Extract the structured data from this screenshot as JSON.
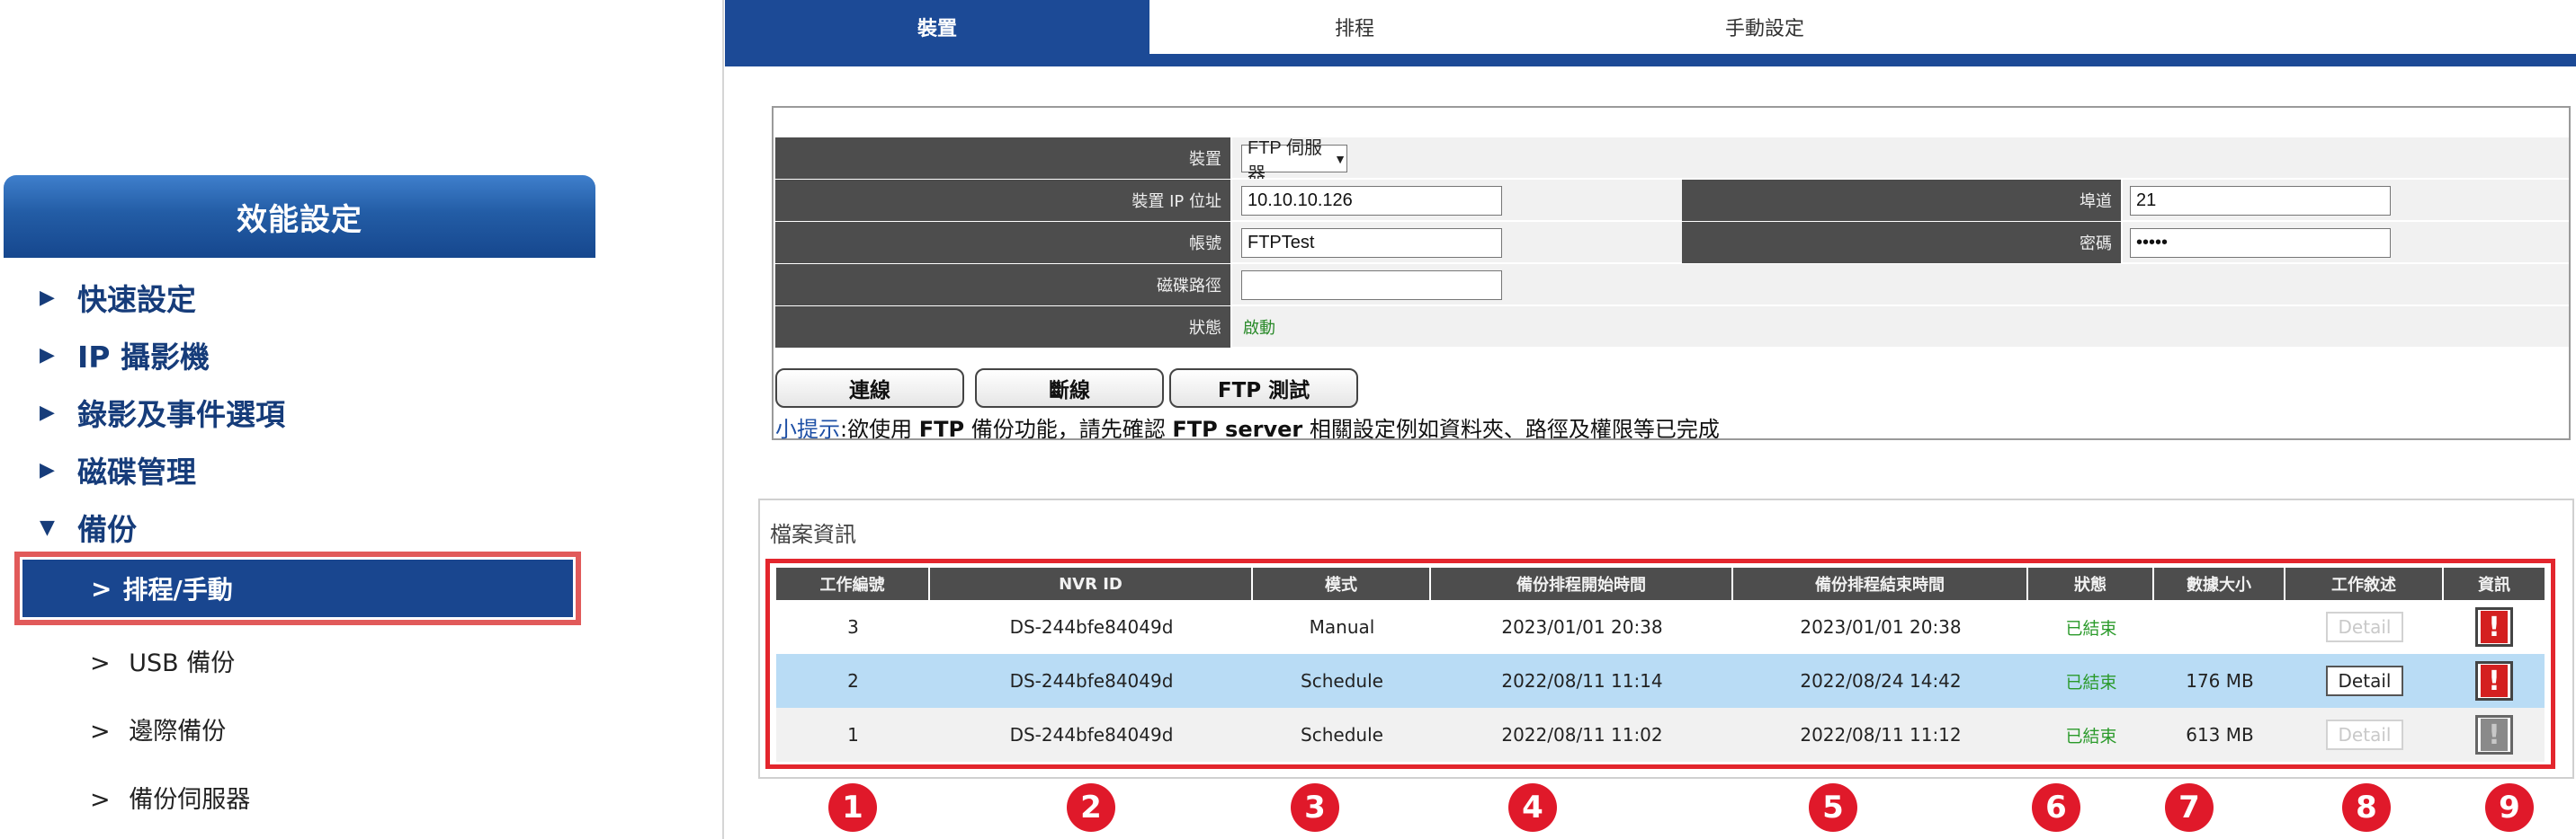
{
  "sidebar": {
    "header": "效能設定",
    "items": [
      {
        "label": "快速設定",
        "expanded": false
      },
      {
        "label": "IP 攝影機",
        "expanded": false
      },
      {
        "label": "錄影及事件選項",
        "expanded": false
      },
      {
        "label": "磁碟管理",
        "expanded": false
      },
      {
        "label": "備份",
        "expanded": true
      }
    ],
    "submenu": [
      {
        "label": "排程/手動",
        "active": true
      },
      {
        "label": "USB 備份",
        "active": false
      },
      {
        "label": "邊際備份",
        "active": false
      },
      {
        "label": "備份伺服器",
        "active": false
      }
    ],
    "collapsed_arrow": "▶",
    "expanded_arrow": "▼",
    "sub_prefix": ">"
  },
  "tabs": [
    {
      "label": "裝置",
      "active": true
    },
    {
      "label": "排程",
      "active": false
    },
    {
      "label": "手動設定",
      "active": false
    }
  ],
  "ftp_form": {
    "device_label": "裝置",
    "device_value": "FTP 伺服器",
    "ip_label": "裝置 IP 位址",
    "ip_value": "10.10.10.126",
    "port_label": "埠道",
    "port_value": "21",
    "account_label": "帳號",
    "account_value": "FTPTest",
    "password_label": "密碼",
    "password_value": "•••••",
    "path_label": "磁碟路徑",
    "path_value": "",
    "status_label": "狀態",
    "status_value": "啟動"
  },
  "buttons": {
    "connect": "連線",
    "disconnect": "斷線",
    "ftp_test": "FTP 測試"
  },
  "hint": {
    "label": "小提示",
    "text_1": ":欲使用 ",
    "bold_1": "FTP",
    "text_2": " 備份功能，請先確認 ",
    "bold_2": "FTP server",
    "text_3": " 相關設定例如資料夾、路徑及權限等已完成"
  },
  "file_info": {
    "title": "檔案資訊",
    "columns": [
      "工作編號",
      "NVR ID",
      "模式",
      "備份排程開始時間",
      "備份排程結束時間",
      "狀態",
      "數據大小",
      "工作敘述",
      "資訊"
    ],
    "rows": [
      {
        "id": "3",
        "nvr_id": "DS-244bfe84049d",
        "mode": "Manual",
        "start": "2023/01/01 20:38",
        "end": "2023/01/01 20:38",
        "status": "已結束",
        "size": "",
        "detail": "Detail",
        "detail_enabled": false,
        "info_enabled": true,
        "highlighted": false
      },
      {
        "id": "2",
        "nvr_id": "DS-244bfe84049d",
        "mode": "Schedule",
        "start": "2022/08/11 11:14",
        "end": "2022/08/24 14:42",
        "status": "已結束",
        "size": "176 MB",
        "detail": "Detail",
        "detail_enabled": true,
        "info_enabled": true,
        "highlighted": true
      },
      {
        "id": "1",
        "nvr_id": "DS-244bfe84049d",
        "mode": "Schedule",
        "start": "2022/08/11 11:02",
        "end": "2022/08/11 11:12",
        "status": "已結束",
        "size": "613 MB",
        "detail": "Detail",
        "detail_enabled": false,
        "info_enabled": false,
        "highlighted": false
      }
    ],
    "info_mark": "!"
  },
  "callouts": [
    "1",
    "2",
    "3",
    "4",
    "5",
    "6",
    "7",
    "8",
    "9"
  ],
  "colors": {
    "brand_blue": "#1c4a96",
    "header_gray": "#4d4d4d",
    "highlight_row": "#b9dcf5",
    "alt_row": "#f1f1f1",
    "callout_red": "#e0192a",
    "outline_red": "#e3262d",
    "status_green": "#2a9a2a"
  }
}
